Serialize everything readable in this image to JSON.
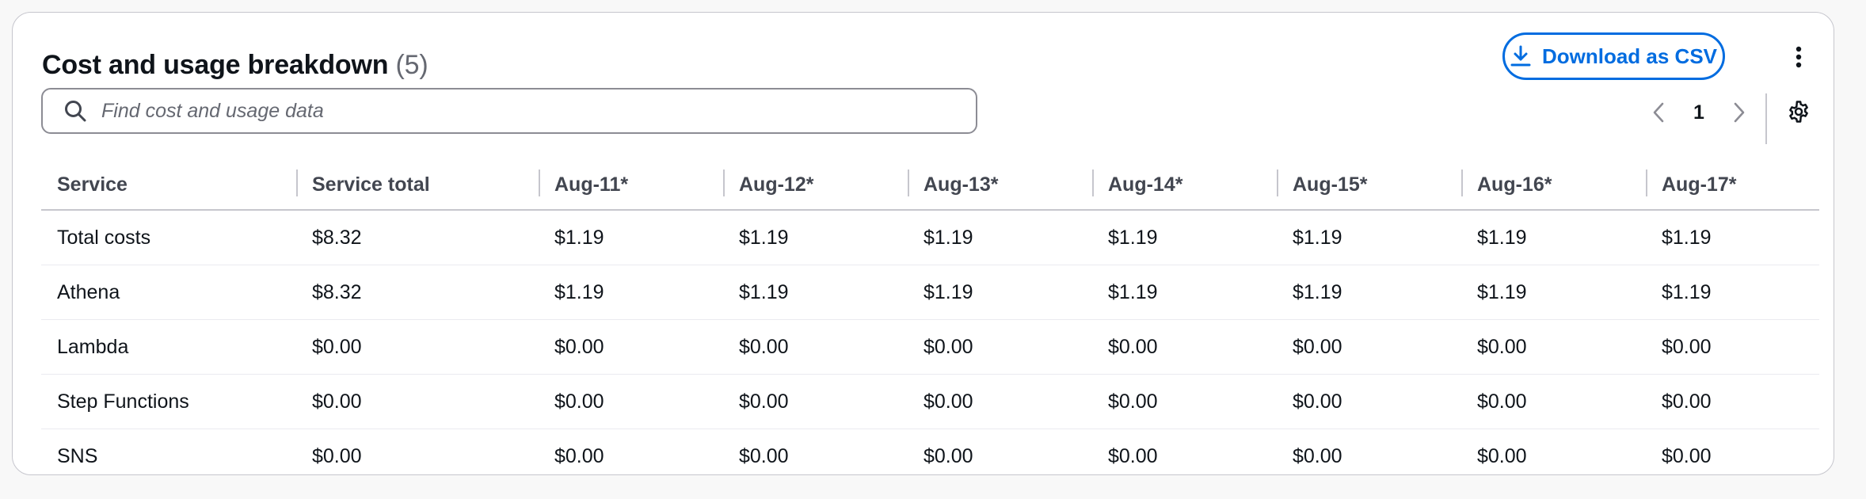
{
  "panel": {
    "title": "Cost and usage breakdown",
    "count": "(5)",
    "download_label": "Download as CSV",
    "search_placeholder": "Find cost and usage data",
    "page": "1"
  },
  "table": {
    "columns": [
      "Service",
      "Service total",
      "Aug-11*",
      "Aug-12*",
      "Aug-13*",
      "Aug-14*",
      "Aug-15*",
      "Aug-16*",
      "Aug-17*"
    ],
    "rows": [
      [
        "Total costs",
        "$8.32",
        "$1.19",
        "$1.19",
        "$1.19",
        "$1.19",
        "$1.19",
        "$1.19",
        "$1.19"
      ],
      [
        "Athena",
        "$8.32",
        "$1.19",
        "$1.19",
        "$1.19",
        "$1.19",
        "$1.19",
        "$1.19",
        "$1.19"
      ],
      [
        "Lambda",
        "$0.00",
        "$0.00",
        "$0.00",
        "$0.00",
        "$0.00",
        "$0.00",
        "$0.00",
        "$0.00"
      ],
      [
        "Step Functions",
        "$0.00",
        "$0.00",
        "$0.00",
        "$0.00",
        "$0.00",
        "$0.00",
        "$0.00",
        "$0.00"
      ],
      [
        "SNS",
        "$0.00",
        "$0.00",
        "$0.00",
        "$0.00",
        "$0.00",
        "$0.00",
        "$0.00",
        "$0.00"
      ]
    ]
  },
  "icons": {
    "download": "download-icon",
    "more": "more-vertical-icon",
    "search": "search-icon",
    "prev": "chevron-left-icon",
    "next": "chevron-right-icon",
    "settings": "gear-icon"
  },
  "colors": {
    "accent": "#006ce0",
    "border": "#c6c6cd",
    "text": "#0f141a",
    "muted": "#656871"
  }
}
